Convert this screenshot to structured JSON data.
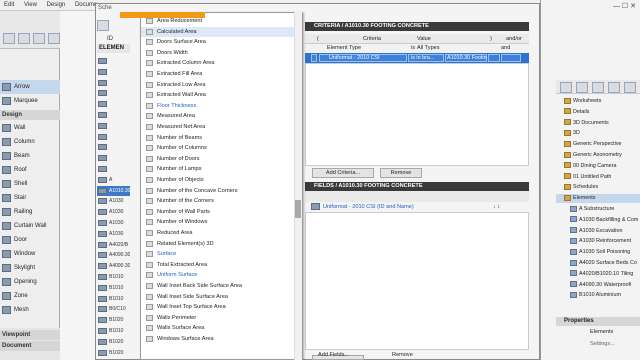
{
  "menubar": [
    "Edit",
    "View",
    "Design",
    "Docume"
  ],
  "toolbox": {
    "top_items": [
      "Arrow",
      "Marquee"
    ],
    "section_label": "Design",
    "tools": [
      "Wall",
      "Column",
      "Beam",
      "Roof",
      "Shell",
      "Stair",
      "Railing",
      "Curtain Wall",
      "Door",
      "Window",
      "Skylight",
      "Opening",
      "Zone",
      "Mesh"
    ],
    "viewpoint": "Viewpoint",
    "document": "Document"
  },
  "scheme": {
    "title": "Sche",
    "id_col": "ID",
    "elements_header": "ELEMEN",
    "element_rows": [
      "",
      "",
      "",
      "",
      "",
      "",
      "",
      "",
      "",
      "",
      "",
      "A",
      "A1010.30",
      "A1030",
      "A1030",
      "A1030",
      "A1030",
      "A4020/B",
      "A4090.30",
      "A4090.30",
      "B1010",
      "B1010",
      "B1010",
      "B0/C10",
      "B1020",
      "B1010",
      "B1020",
      "B1020"
    ],
    "element_selected_index": 12
  },
  "dropdown": {
    "items": [
      "Area Reducement",
      "Calculated Area",
      "Doors Surface Area",
      "Doors Width",
      "Extracted Column Area",
      "Extracted Fill Area",
      "Extracted Low Area",
      "Extracted Wall Area",
      "Floor Thickness",
      "Measured Area",
      "Measured Net Area",
      "Number of Beams",
      "Number of Columns",
      "Number of Doors",
      "Number of Lamps",
      "Number of Objects",
      "Number of the Concave Corners",
      "Number of the Corners",
      "Number of Wall Parts",
      "Number of Windows",
      "Reduced Area",
      "Related Element(s) 3D",
      "Surface",
      "Total Extracted Area",
      "Uniform Surface",
      "Wall Inset Back Side Surface Area",
      "Wall Inset Side Surface Area",
      "Wall Inset Top Surface Area",
      "Walls Perimeter",
      "Walls Surface Area",
      "Windows Surface Area"
    ],
    "highlighted_index": 1,
    "blue_indexes": [
      8,
      22,
      24
    ]
  },
  "criteria": {
    "header": "CRITERIA / A1010.30 FOOTING CONCRETE",
    "open_paren": "(",
    "criteria_label": "Criteria",
    "value_label": "Value",
    "close_paren": ")",
    "andor_label": "and/or",
    "col_element_type": "Element Type",
    "col_is": "is",
    "col_all_types": "All Types",
    "col_and": "and",
    "row_criteria": "Uniformat - 2010 CSI",
    "row_op": "is in bra...",
    "row_value": "A1010.30 Footing Fo...",
    "add_button": "Add Criteria...",
    "remove_button": "Remove"
  },
  "fields": {
    "header": "FIELDS / A1010.30 FOOTING CONCRETE",
    "field_name": "Uniformat - 2010 CSI (ID and Name)",
    "add_button": "Add Fields...",
    "remove_button": "Remove"
  },
  "navigator": {
    "items": [
      {
        "label": "Worksheets",
        "type": "folder"
      },
      {
        "label": "Details",
        "type": "folder"
      },
      {
        "label": "3D Documents",
        "type": "folder"
      },
      {
        "label": "3D",
        "type": "folder"
      },
      {
        "label": "Generic Perspective",
        "type": "folder"
      },
      {
        "label": "Generic Axonometry",
        "type": "folder"
      },
      {
        "label": "00 Dining Camera",
        "type": "folder"
      },
      {
        "label": "01 Untitled Path",
        "type": "folder"
      },
      {
        "label": "Schedules",
        "type": "folder"
      },
      {
        "label": "Elements",
        "type": "folder"
      },
      {
        "label": "A Substructure",
        "type": "elem"
      },
      {
        "label": "A1030 Backfilling & Com",
        "type": "elem"
      },
      {
        "label": "A1030 Excavation",
        "type": "elem"
      },
      {
        "label": "A1030 Reinforcement",
        "type": "elem"
      },
      {
        "label": "A1030 Soil Poisoning",
        "type": "elem"
      },
      {
        "label": "A4020 Surface Beds Co",
        "type": "elem"
      },
      {
        "label": "A4020/B1020.10 Tiling",
        "type": "elem"
      },
      {
        "label": "A4090.30 Waterproofi",
        "type": "elem"
      },
      {
        "label": "B1010 Aluminium",
        "type": "elem"
      }
    ],
    "selected_index": 9,
    "properties_header": "Properties",
    "properties_value": "Elements",
    "settings_label": "Settings..."
  },
  "window_controls": "— ☐ ✕"
}
